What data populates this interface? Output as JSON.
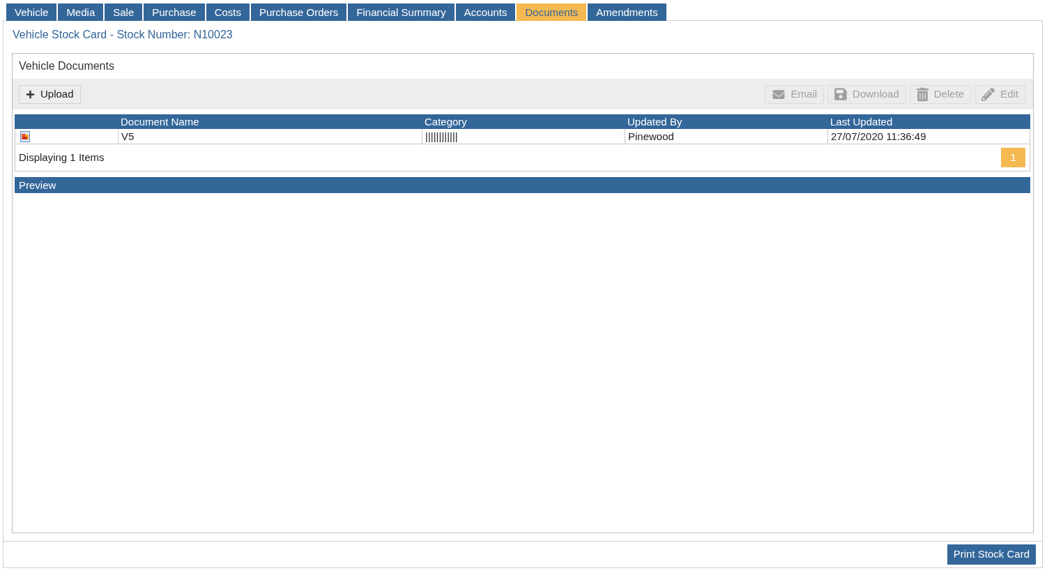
{
  "tabs": [
    {
      "label": "Vehicle",
      "selected": false
    },
    {
      "label": "Media",
      "selected": false
    },
    {
      "label": "Sale",
      "selected": false
    },
    {
      "label": "Purchase",
      "selected": false
    },
    {
      "label": "Costs",
      "selected": false
    },
    {
      "label": "Purchase Orders",
      "selected": false
    },
    {
      "label": "Financial Summary",
      "selected": false
    },
    {
      "label": "Accounts",
      "selected": false
    },
    {
      "label": "Documents",
      "selected": true
    },
    {
      "label": "Amendments",
      "selected": false
    }
  ],
  "page_title": "Vehicle Stock Card - Stock Number: N10023",
  "panel": {
    "title": "Vehicle Documents",
    "toolbar": {
      "left": [
        {
          "label": "Upload",
          "disabled": false
        }
      ],
      "right": [
        {
          "label": "Email",
          "disabled": true
        },
        {
          "label": "Download",
          "disabled": true
        },
        {
          "label": "Delete",
          "disabled": true
        },
        {
          "label": "Edit",
          "disabled": true
        }
      ]
    },
    "table": {
      "columns": [
        "Document Name",
        "Category",
        "Updated By",
        "Last Updated"
      ],
      "rows": [
        {
          "cells": [
            "V5",
            "||||||||||||",
            "Pinewood",
            "27/07/2020 11:36:49"
          ]
        }
      ]
    },
    "pager": {
      "summary": "Displaying 1 Items",
      "pages": [
        {
          "label": "1",
          "selected": true
        }
      ]
    },
    "preview": {
      "title": "Preview"
    }
  },
  "footer": {
    "buttons": [
      "Print Stock Card"
    ]
  }
}
